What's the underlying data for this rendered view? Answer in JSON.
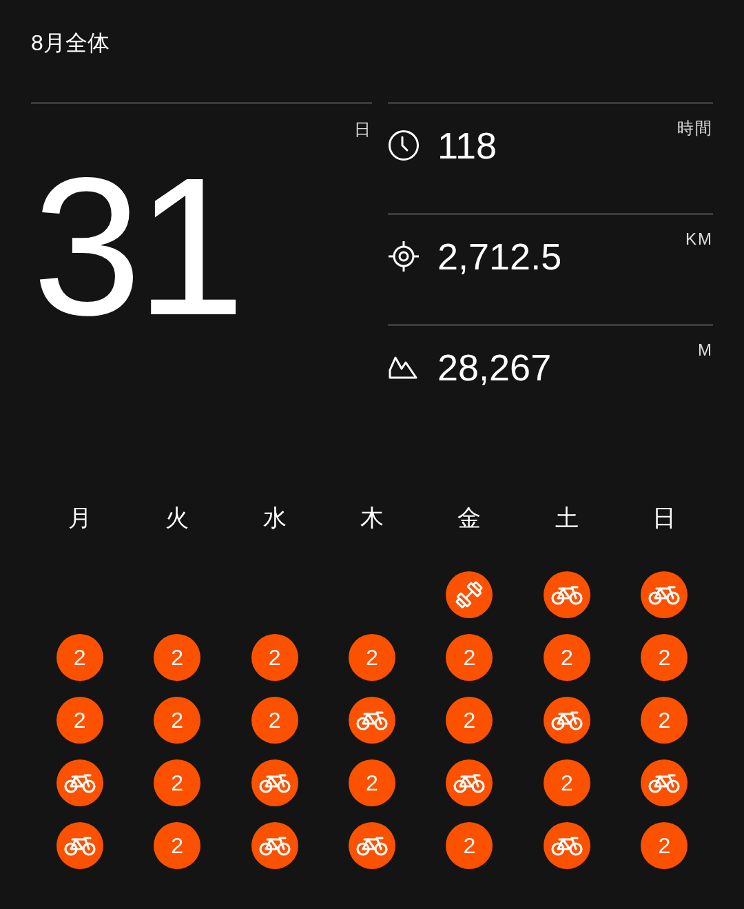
{
  "title": "8月全体",
  "days": {
    "value": "31",
    "unit": "日"
  },
  "stats": [
    {
      "kind": "time",
      "value": "118",
      "unit": "時間"
    },
    {
      "kind": "distance",
      "value": "2,712.5",
      "unit": "KM"
    },
    {
      "kind": "elevation",
      "value": "28,267",
      "unit": "M"
    }
  ],
  "weekdays": [
    "月",
    "火",
    "水",
    "木",
    "金",
    "土",
    "日"
  ],
  "weeks": [
    [
      {
        "kind": "blank"
      },
      {
        "kind": "blank"
      },
      {
        "kind": "blank"
      },
      {
        "kind": "blank"
      },
      {
        "kind": "strength"
      },
      {
        "kind": "bike"
      },
      {
        "kind": "bike"
      }
    ],
    [
      {
        "kind": "count",
        "text": "2"
      },
      {
        "kind": "count",
        "text": "2"
      },
      {
        "kind": "count",
        "text": "2"
      },
      {
        "kind": "count",
        "text": "2"
      },
      {
        "kind": "count",
        "text": "2"
      },
      {
        "kind": "count",
        "text": "2"
      },
      {
        "kind": "count",
        "text": "2"
      }
    ],
    [
      {
        "kind": "count",
        "text": "2"
      },
      {
        "kind": "count",
        "text": "2"
      },
      {
        "kind": "count",
        "text": "2"
      },
      {
        "kind": "bike"
      },
      {
        "kind": "count",
        "text": "2"
      },
      {
        "kind": "bike"
      },
      {
        "kind": "count",
        "text": "2"
      }
    ],
    [
      {
        "kind": "bike"
      },
      {
        "kind": "count",
        "text": "2"
      },
      {
        "kind": "bike"
      },
      {
        "kind": "count",
        "text": "2"
      },
      {
        "kind": "bike"
      },
      {
        "kind": "count",
        "text": "2"
      },
      {
        "kind": "bike"
      }
    ],
    [
      {
        "kind": "bike"
      },
      {
        "kind": "count",
        "text": "2"
      },
      {
        "kind": "bike"
      },
      {
        "kind": "bike"
      },
      {
        "kind": "count",
        "text": "2"
      },
      {
        "kind": "bike"
      },
      {
        "kind": "count",
        "text": "2"
      }
    ]
  ]
}
